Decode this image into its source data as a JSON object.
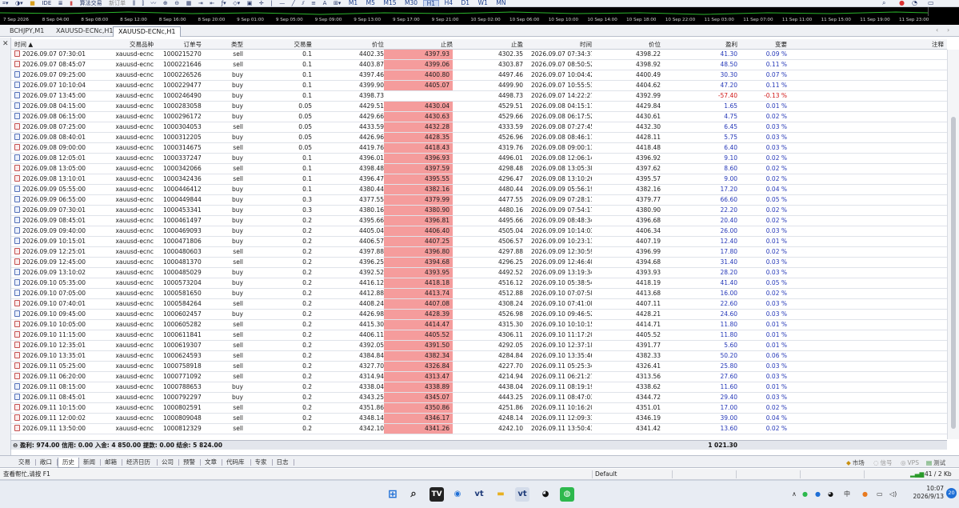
{
  "toolbar": {
    "algo_trading": "算法交易",
    "new_order": "新订单",
    "timeframes": [
      "M1",
      "M5",
      "M15",
      "M30",
      "H1",
      "H4",
      "D1",
      "W1",
      "MN"
    ],
    "active_timeframe": "H1"
  },
  "time_axis": [
    "7 Sep 2026",
    "8 Sep 04:00",
    "8 Sep 08:00",
    "8 Sep 12:00",
    "8 Sep 16:00",
    "8 Sep 20:00",
    "9 Sep 01:00",
    "9 Sep 05:00",
    "9 Sep 09:00",
    "9 Sep 13:00",
    "9 Sep 17:00",
    "9 Sep 21:00",
    "10 Sep 02:00",
    "10 Sep 06:00",
    "10 Sep 10:00",
    "10 Sep 14:00",
    "10 Sep 18:00",
    "10 Sep 22:00",
    "11 Sep 03:00",
    "11 Sep 07:00",
    "11 Sep 11:00",
    "11 Sep 15:00",
    "11 Sep 19:00",
    "11 Sep 23:00"
  ],
  "chart_tabs": [
    "BCHJPY,M1",
    "XAUUSD-ECNc,H1",
    "XAUUSD-ECNc,H1"
  ],
  "active_chart_tab": 2,
  "columns": {
    "time": "时间",
    "symbol": "交易品种",
    "order": "订单号",
    "type": "类型",
    "volume": "交易量",
    "price": "价位",
    "sl": "止损",
    "tp": "止盈",
    "close_time": "时间",
    "close_price": "价位",
    "profit": "盈利",
    "change": "变要",
    "comment": "注释"
  },
  "trades": [
    {
      "time": "2026.09.07 07:30:01",
      "symbol": "xauusd-ecnc",
      "order": "10002152702",
      "type": "sell",
      "volume": "0.1",
      "price": "4402.35",
      "sl": "4397.93",
      "tp": "4302.35",
      "close_time": "2026.09.07 07:34:37",
      "close_price": "4398.22",
      "profit": "41.30",
      "change": "0.09 %"
    },
    {
      "time": "2026.09.07 08:45:07",
      "symbol": "xauusd-ecnc",
      "order": "10002216464",
      "type": "sell",
      "volume": "0.1",
      "price": "4403.87",
      "sl": "4399.06",
      "tp": "4303.87",
      "close_time": "2026.09.07 08:50:52",
      "close_price": "4398.92",
      "profit": "48.50",
      "change": "0.11 %"
    },
    {
      "time": "2026.09.07 09:25:00",
      "symbol": "xauusd-ecnc",
      "order": "10002265262",
      "type": "buy",
      "volume": "0.1",
      "price": "4397.46",
      "sl": "4400.80",
      "tp": "4497.46",
      "close_time": "2026.09.07 10:04:42",
      "close_price": "4400.49",
      "profit": "30.30",
      "change": "0.07 %"
    },
    {
      "time": "2026.09.07 10:10:04",
      "symbol": "xauusd-ecnc",
      "order": "10002294779",
      "type": "buy",
      "volume": "0.1",
      "price": "4399.90",
      "sl": "4405.07",
      "tp": "4499.90",
      "close_time": "2026.09.07 10:55:53",
      "close_price": "4404.62",
      "profit": "47.20",
      "change": "0.11 %"
    },
    {
      "time": "2026.09.07 13:45:00",
      "symbol": "xauusd-ecnc",
      "order": "10002464908",
      "type": "buy",
      "volume": "0.1",
      "price": "4398.73",
      "sl": "",
      "tp": "4498.73",
      "close_time": "2026.09.07 14:22:27",
      "close_price": "4392.99",
      "profit": "-57.40",
      "change": "-0.13 %"
    },
    {
      "time": "2026.09.08 04:15:00",
      "symbol": "xauusd-ecnc",
      "order": "10002830580",
      "type": "buy",
      "volume": "0.05",
      "price": "4429.51",
      "sl": "4430.04",
      "tp": "4529.51",
      "close_time": "2026.09.08 04:15:11",
      "close_price": "4429.84",
      "profit": "1.65",
      "change": "0.01 %"
    },
    {
      "time": "2026.09.08 06:15:00",
      "symbol": "xauusd-ecnc",
      "order": "10002961728",
      "type": "buy",
      "volume": "0.05",
      "price": "4429.66",
      "sl": "4430.63",
      "tp": "4529.66",
      "close_time": "2026.09.08 06:17:52",
      "close_price": "4430.61",
      "profit": "4.75",
      "change": "0.02 %"
    },
    {
      "time": "2026.09.08 07:25:00",
      "symbol": "xauusd-ecnc",
      "order": "10003040532",
      "type": "sell",
      "volume": "0.05",
      "price": "4433.59",
      "sl": "4432.28",
      "tp": "4333.59",
      "close_time": "2026.09.08 07:27:45",
      "close_price": "4432.30",
      "profit": "6.45",
      "change": "0.03 %"
    },
    {
      "time": "2026.09.08 08:40:01",
      "symbol": "xauusd-ecnc",
      "order": "10003122050",
      "type": "buy",
      "volume": "0.05",
      "price": "4426.96",
      "sl": "4428.35",
      "tp": "4526.96",
      "close_time": "2026.09.08 08:46:11",
      "close_price": "4428.11",
      "profit": "5.75",
      "change": "0.03 %"
    },
    {
      "time": "2026.09.08 09:00:00",
      "symbol": "xauusd-ecnc",
      "order": "10003146754",
      "type": "sell",
      "volume": "0.05",
      "price": "4419.76",
      "sl": "4418.43",
      "tp": "4319.76",
      "close_time": "2026.09.08 09:00:13",
      "close_price": "4418.48",
      "profit": "6.40",
      "change": "0.03 %"
    },
    {
      "time": "2026.09.08 12:05:01",
      "symbol": "xauusd-ecnc",
      "order": "10003372471",
      "type": "buy",
      "volume": "0.1",
      "price": "4396.01",
      "sl": "4396.93",
      "tp": "4496.01",
      "close_time": "2026.09.08 12:06:14",
      "close_price": "4396.92",
      "profit": "9.10",
      "change": "0.02 %"
    },
    {
      "time": "2026.09.08 13:05:00",
      "symbol": "xauusd-ecnc",
      "order": "10003420668",
      "type": "sell",
      "volume": "0.1",
      "price": "4398.48",
      "sl": "4397.59",
      "tp": "4298.48",
      "close_time": "2026.09.08 13:05:38",
      "close_price": "4397.62",
      "profit": "8.60",
      "change": "0.02 %"
    },
    {
      "time": "2026.09.08 13:10:01",
      "symbol": "xauusd-ecnc",
      "order": "10003424360",
      "type": "sell",
      "volume": "0.1",
      "price": "4396.47",
      "sl": "4395.55",
      "tp": "4296.47",
      "close_time": "2026.09.08 13:10:26",
      "close_price": "4395.57",
      "profit": "9.00",
      "change": "0.02 %"
    },
    {
      "time": "2026.09.09 05:55:00",
      "symbol": "xauusd-ecnc",
      "order": "10004464124",
      "type": "buy",
      "volume": "0.1",
      "price": "4380.44",
      "sl": "4382.16",
      "tp": "4480.44",
      "close_time": "2026.09.09 05:56:19",
      "close_price": "4382.16",
      "profit": "17.20",
      "change": "0.04 %"
    },
    {
      "time": "2026.09.09 06:55:00",
      "symbol": "xauusd-ecnc",
      "order": "10004498443",
      "type": "buy",
      "volume": "0.3",
      "price": "4377.55",
      "sl": "4379.99",
      "tp": "4477.55",
      "close_time": "2026.09.09 07:28:11",
      "close_price": "4379.77",
      "profit": "66.60",
      "change": "0.05 %"
    },
    {
      "time": "2026.09.09 07:30:01",
      "symbol": "xauusd-ecnc",
      "order": "10004533410",
      "type": "buy",
      "volume": "0.3",
      "price": "4380.16",
      "sl": "4380.90",
      "tp": "4480.16",
      "close_time": "2026.09.09 07:54:17",
      "close_price": "4380.90",
      "profit": "22.20",
      "change": "0.02 %"
    },
    {
      "time": "2026.09.09 08:45:01",
      "symbol": "xauusd-ecnc",
      "order": "10004614977",
      "type": "buy",
      "volume": "0.2",
      "price": "4395.66",
      "sl": "4396.81",
      "tp": "4495.66",
      "close_time": "2026.09.09 08:48:34",
      "close_price": "4396.68",
      "profit": "20.40",
      "change": "0.02 %"
    },
    {
      "time": "2026.09.09 09:40:00",
      "symbol": "xauusd-ecnc",
      "order": "10004690933",
      "type": "buy",
      "volume": "0.2",
      "price": "4405.04",
      "sl": "4406.40",
      "tp": "4505.04",
      "close_time": "2026.09.09 10:14:03",
      "close_price": "4406.34",
      "profit": "26.00",
      "change": "0.03 %"
    },
    {
      "time": "2026.09.09 10:15:01",
      "symbol": "xauusd-ecnc",
      "order": "10004718061",
      "type": "buy",
      "volume": "0.2",
      "price": "4406.57",
      "sl": "4407.25",
      "tp": "4506.57",
      "close_time": "2026.09.09 10:23:13",
      "close_price": "4407.19",
      "profit": "12.40",
      "change": "0.01 %"
    },
    {
      "time": "2026.09.09 12:25:01",
      "symbol": "xauusd-ecnc",
      "order": "10004806037",
      "type": "sell",
      "volume": "0.2",
      "price": "4397.88",
      "sl": "4396.80",
      "tp": "4297.88",
      "close_time": "2026.09.09 12:30:59",
      "close_price": "4396.99",
      "profit": "17.80",
      "change": "0.02 %"
    },
    {
      "time": "2026.09.09 12:45:00",
      "symbol": "xauusd-ecnc",
      "order": "10004813703",
      "type": "sell",
      "volume": "0.2",
      "price": "4396.25",
      "sl": "4394.68",
      "tp": "4296.25",
      "close_time": "2026.09.09 12:46:40",
      "close_price": "4394.68",
      "profit": "31.40",
      "change": "0.03 %"
    },
    {
      "time": "2026.09.09 13:10:02",
      "symbol": "xauusd-ecnc",
      "order": "10004850296",
      "type": "buy",
      "volume": "0.2",
      "price": "4392.52",
      "sl": "4393.95",
      "tp": "4492.52",
      "close_time": "2026.09.09 13:19:34",
      "close_price": "4393.93",
      "profit": "28.20",
      "change": "0.03 %"
    },
    {
      "time": "2026.09.10 05:35:00",
      "symbol": "xauusd-ecnc",
      "order": "10005732048",
      "type": "buy",
      "volume": "0.2",
      "price": "4416.12",
      "sl": "4418.18",
      "tp": "4516.12",
      "close_time": "2026.09.10 05:38:54",
      "close_price": "4418.19",
      "profit": "41.40",
      "change": "0.05 %"
    },
    {
      "time": "2026.09.10 07:05:00",
      "symbol": "xauusd-ecnc",
      "order": "10005816509",
      "type": "buy",
      "volume": "0.2",
      "price": "4412.88",
      "sl": "4413.74",
      "tp": "4512.88",
      "close_time": "2026.09.10 07:07:58",
      "close_price": "4413.68",
      "profit": "16.00",
      "change": "0.02 %"
    },
    {
      "time": "2026.09.10 07:40:01",
      "symbol": "xauusd-ecnc",
      "order": "10005842648",
      "type": "sell",
      "volume": "0.2",
      "price": "4408.24",
      "sl": "4407.08",
      "tp": "4308.24",
      "close_time": "2026.09.10 07:41:08",
      "close_price": "4407.11",
      "profit": "22.60",
      "change": "0.03 %"
    },
    {
      "time": "2026.09.10 09:45:00",
      "symbol": "xauusd-ecnc",
      "order": "10006024570",
      "type": "buy",
      "volume": "0.2",
      "price": "4426.98",
      "sl": "4428.39",
      "tp": "4526.98",
      "close_time": "2026.09.10 09:46:52",
      "close_price": "4428.21",
      "profit": "24.60",
      "change": "0.03 %"
    },
    {
      "time": "2026.09.10 10:05:00",
      "symbol": "xauusd-ecnc",
      "order": "10006052823",
      "type": "sell",
      "volume": "0.2",
      "price": "4415.30",
      "sl": "4414.47",
      "tp": "4315.30",
      "close_time": "2026.09.10 10:10:15",
      "close_price": "4414.71",
      "profit": "11.80",
      "change": "0.01 %"
    },
    {
      "time": "2026.09.10 11:15:00",
      "symbol": "xauusd-ecnc",
      "order": "10006118410",
      "type": "sell",
      "volume": "0.2",
      "price": "4406.11",
      "sl": "4405.52",
      "tp": "4306.11",
      "close_time": "2026.09.10 11:17:20",
      "close_price": "4405.52",
      "profit": "11.80",
      "change": "0.01 %"
    },
    {
      "time": "2026.09.10 12:35:01",
      "symbol": "xauusd-ecnc",
      "order": "10006193073",
      "type": "sell",
      "volume": "0.2",
      "price": "4392.05",
      "sl": "4391.50",
      "tp": "4292.05",
      "close_time": "2026.09.10 12:37:18",
      "close_price": "4391.77",
      "profit": "5.60",
      "change": "0.01 %"
    },
    {
      "time": "2026.09.10 13:35:01",
      "symbol": "xauusd-ecnc",
      "order": "10006245934",
      "type": "sell",
      "volume": "0.2",
      "price": "4384.84",
      "sl": "4382.34",
      "tp": "4284.84",
      "close_time": "2026.09.10 13:35:46",
      "close_price": "4382.33",
      "profit": "50.20",
      "change": "0.06 %"
    },
    {
      "time": "2026.09.11 05:25:00",
      "symbol": "xauusd-ecnc",
      "order": "10007589185",
      "type": "sell",
      "volume": "0.2",
      "price": "4327.70",
      "sl": "4326.84",
      "tp": "4227.70",
      "close_time": "2026.09.11 05:25:34",
      "close_price": "4326.41",
      "profit": "25.80",
      "change": "0.03 %"
    },
    {
      "time": "2026.09.11 06:20:00",
      "symbol": "xauusd-ecnc",
      "order": "10007710922",
      "type": "sell",
      "volume": "0.2",
      "price": "4314.94",
      "sl": "4313.47",
      "tp": "4214.94",
      "close_time": "2026.09.11 06:21:27",
      "close_price": "4313.56",
      "profit": "27.60",
      "change": "0.03 %"
    },
    {
      "time": "2026.09.11 08:15:00",
      "symbol": "xauusd-ecnc",
      "order": "10007886533",
      "type": "buy",
      "volume": "0.2",
      "price": "4338.04",
      "sl": "4338.89",
      "tp": "4438.04",
      "close_time": "2026.09.11 08:19:19",
      "close_price": "4338.62",
      "profit": "11.60",
      "change": "0.01 %"
    },
    {
      "time": "2026.09.11 08:45:01",
      "symbol": "xauusd-ecnc",
      "order": "10007922970",
      "type": "buy",
      "volume": "0.2",
      "price": "4343.25",
      "sl": "4345.07",
      "tp": "4443.25",
      "close_time": "2026.09.11 08:47:03",
      "close_price": "4344.72",
      "profit": "29.40",
      "change": "0.03 %"
    },
    {
      "time": "2026.09.11 10:15:00",
      "symbol": "xauusd-ecnc",
      "order": "10008025916",
      "type": "sell",
      "volume": "0.2",
      "price": "4351.86",
      "sl": "4350.86",
      "tp": "4251.86",
      "close_time": "2026.09.11 10:16:20",
      "close_price": "4351.01",
      "profit": "17.00",
      "change": "0.02 %"
    },
    {
      "time": "2026.09.11 12:00:02",
      "symbol": "xauusd-ecnc",
      "order": "10008090486",
      "type": "sell",
      "volume": "0.2",
      "price": "4348.14",
      "sl": "4346.17",
      "tp": "4248.14",
      "close_time": "2026.09.11 12:09:33",
      "close_price": "4346.19",
      "profit": "39.00",
      "change": "0.04 %"
    },
    {
      "time": "2026.09.11 13:50:00",
      "symbol": "xauusd-ecnc",
      "order": "10008123295",
      "type": "sell",
      "volume": "0.2",
      "price": "4342.10",
      "sl": "4341.26",
      "tp": "4242.10",
      "close_time": "2026.09.11 13:50:43",
      "close_price": "4341.42",
      "profit": "13.60",
      "change": "0.02 %"
    }
  ],
  "summary": {
    "text": "盈利: 974.00  信用: 0.00  入金: 4 850.00  提款: 0.00  结余: 5 824.00",
    "total": "1 021.30"
  },
  "bottom_tabs": [
    "交易",
    "敞口",
    "历史",
    "新闻",
    "邮箱",
    "经济日历",
    "公司",
    "预警",
    "文章",
    "代码库",
    "专家",
    "日志"
  ],
  "active_bottom_tab": "历史",
  "bottom_right": {
    "market": "市场",
    "signals": "信号",
    "vps": "VPS",
    "tester": "测试"
  },
  "statusbar": {
    "help": "查看帮忙,请按 F1",
    "profile": "Default",
    "traffic": "41 / 2 Kb"
  },
  "taskbar": {
    "time": "10:07",
    "date": "2026/9/13",
    "lang": "中",
    "notif_count": "20"
  },
  "colors": {
    "sl_highlight": "#f59c9c",
    "profit_pos": "#2437b8",
    "profit_neg": "#d01818"
  }
}
